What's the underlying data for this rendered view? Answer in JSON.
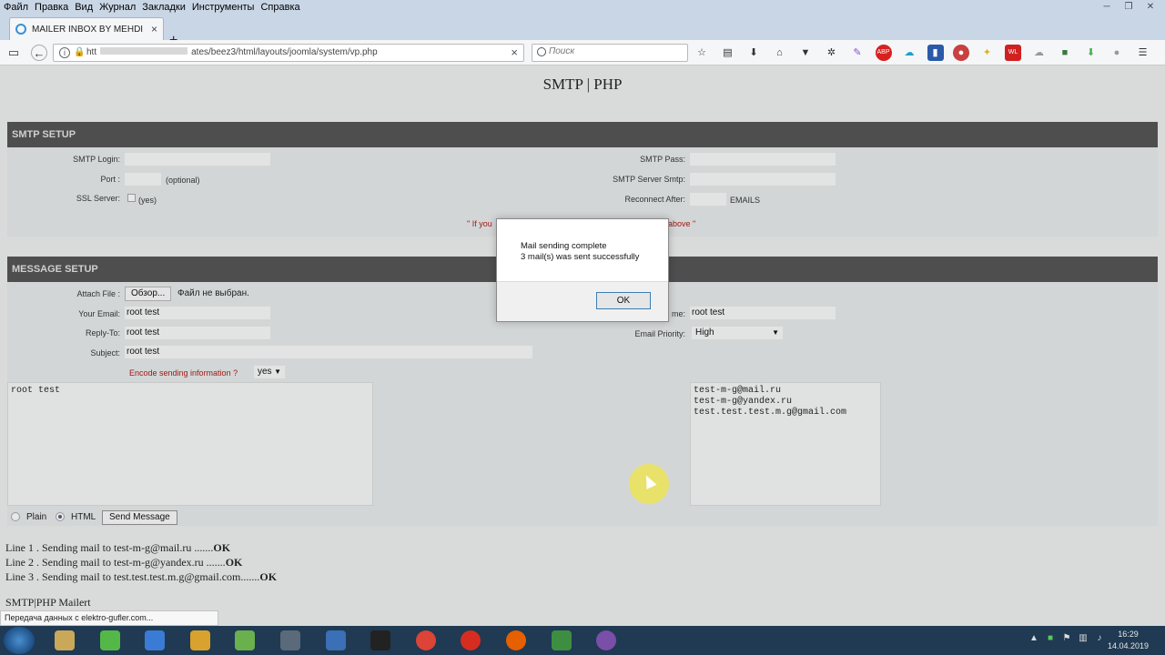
{
  "browser": {
    "menu": [
      "Файл",
      "Правка",
      "Вид",
      "Журнал",
      "Закладки",
      "Инструменты",
      "Справка"
    ],
    "tab_title": "MAILER INBOX BY MEHDI",
    "url_prefix": "htt",
    "url_text": "ates/beez3/html/layouts/joomla/system/vp.php",
    "search_placeholder": "Поиск",
    "wl_badge": "WL"
  },
  "page": {
    "title": "SMTP | PHP",
    "smtp": {
      "heading": "SMTP SETUP",
      "login_label": "SMTP Login:",
      "port_label": "Port :",
      "port_note": "(optional)",
      "ssl_label": "SSL Server:",
      "ssl_note": "(yes)",
      "pass_label": "SMTP Pass:",
      "server_label": "SMTP Server Smtp:",
      "reconnect_label": "Reconnect After:",
      "reconnect_note": "EMAILS",
      "warning_left": "\" If you",
      "warning_right": "above \""
    },
    "message": {
      "heading": "MESSAGE SETUP",
      "attach_label": "Attach File :",
      "browse_label": "Обзор...",
      "no_file": "Файл не выбран.",
      "email_label": "Your Email:",
      "email_value": "root test",
      "reply_label": "Reply-To:",
      "reply_value": "root test",
      "subject_label": "Subject:",
      "subject_value": "root test",
      "encode_label": "Encode sending information ?",
      "encode_value": "yes",
      "name_label": "me:",
      "name_value": "root test",
      "priority_label": "Email Priority:",
      "priority_value": "High",
      "body_text": "root test",
      "recipients": "test-m-g@mail.ru\ntest-m-g@yandex.ru\ntest.test.test.m.g@gmail.com",
      "plain_label": "Plain",
      "html_label": "HTML",
      "send_label": "Send Message"
    },
    "results": [
      {
        "text": "Line 1 . Sending mail to test-m-g@mail.ru .......",
        "status": "OK"
      },
      {
        "text": "Line 2 . Sending mail to test-m-g@yandex.ru .......",
        "status": "OK"
      },
      {
        "text": "Line 3 . Sending mail to test.test.test.m.g@gmail.com.......",
        "status": "OK"
      }
    ],
    "footer": "SMTP|PHP Mailert"
  },
  "dialog": {
    "line1": "Mail sending complete",
    "line2": "3 mail(s) was sent successfully",
    "ok_label": "OK"
  },
  "status_text": "Передача данных с elektro-gufler.com...",
  "taskbar": {
    "time": "16:29",
    "date": "14.04.2019",
    "app_colors": [
      "#c9a85a",
      "#53b848",
      "#3a7bd5",
      "#d9a22e",
      "#6ab04c",
      "#5a6a7a",
      "#3b6fb6",
      "#222222",
      "#db4437",
      "#d62d20",
      "#e66000",
      "#3e8e41",
      "#7a4fa8"
    ]
  }
}
